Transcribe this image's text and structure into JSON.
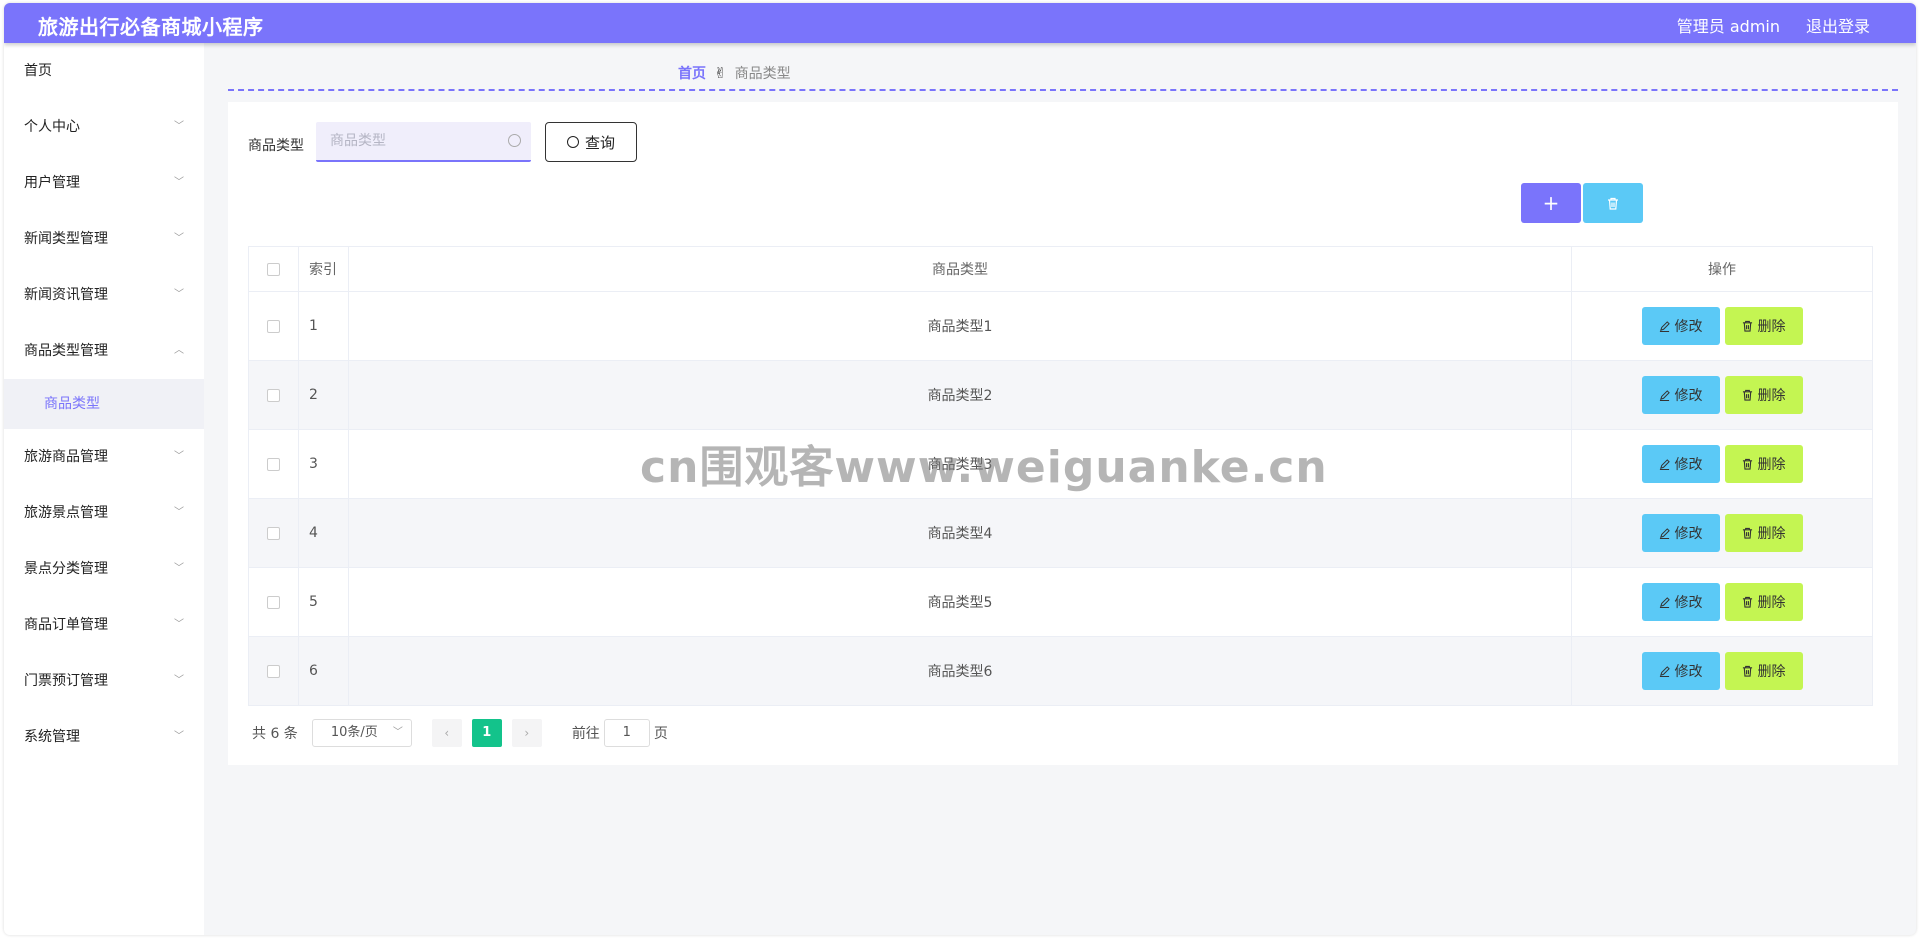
{
  "header": {
    "app_title": "旅游出行必备商城小程序",
    "admin_label": "管理员 admin",
    "logout_label": "退出登录",
    "accent_color": "#7a74fb"
  },
  "sidebar": {
    "items": [
      {
        "label": "首页",
        "has_chevron": false
      },
      {
        "label": "个人中心",
        "has_chevron": true
      },
      {
        "label": "用户管理",
        "has_chevron": true
      },
      {
        "label": "新闻类型管理",
        "has_chevron": true
      },
      {
        "label": "新闻资讯管理",
        "has_chevron": true
      },
      {
        "label": "商品类型管理",
        "has_chevron": true,
        "expanded": true
      },
      {
        "label": "旅游商品管理",
        "has_chevron": true
      },
      {
        "label": "旅游景点管理",
        "has_chevron": true
      },
      {
        "label": "景点分类管理",
        "has_chevron": true
      },
      {
        "label": "商品订单管理",
        "has_chevron": true
      },
      {
        "label": "门票预订管理",
        "has_chevron": true
      },
      {
        "label": "系统管理",
        "has_chevron": true
      }
    ],
    "active_sub": "商品类型"
  },
  "breadcrumb": {
    "home": "首页",
    "current": "商品类型"
  },
  "search": {
    "label": "商品类型",
    "placeholder": "商品类型",
    "value": "",
    "button_label": "查询"
  },
  "toolbar": {
    "add_icon": "plus-icon",
    "batch_delete_icon": "trash-icon"
  },
  "table": {
    "headers": {
      "index": "索引",
      "type": "商品类型",
      "ops": "操作"
    },
    "edit_label": "修改",
    "delete_label": "删除",
    "rows": [
      {
        "index": "1",
        "type": "商品类型1"
      },
      {
        "index": "2",
        "type": "商品类型2"
      },
      {
        "index": "3",
        "type": "商品类型3"
      },
      {
        "index": "4",
        "type": "商品类型4"
      },
      {
        "index": "5",
        "type": "商品类型5"
      },
      {
        "index": "6",
        "type": "商品类型6"
      }
    ]
  },
  "pagination": {
    "total": "共 6 条",
    "page_size": "10条/页",
    "current_page": "1",
    "goto_label": "前往",
    "goto_value": "1",
    "page_suffix": "页"
  },
  "watermark": "cn围观客www.weiguanke.cn"
}
